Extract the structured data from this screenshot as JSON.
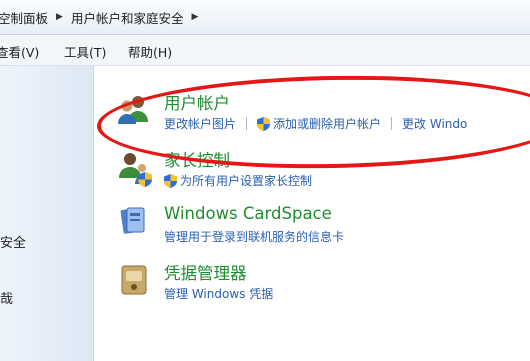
{
  "breadcrumb": {
    "items": [
      "控制面板",
      "用户帐户和家庭安全"
    ],
    "leading_partial": "空制面板"
  },
  "menu": {
    "view": "查看(V)",
    "tools": "工具(T)",
    "help": "帮助(H)"
  },
  "left_pane": {
    "partial_link_1": "安全",
    "partial_link_2": "哉"
  },
  "categories": [
    {
      "title": "用户帐户",
      "icon": "users-icon",
      "links": [
        "更改帐户图片",
        "添加或删除用户帐户",
        "更改 Windo"
      ]
    },
    {
      "title": "家长控制",
      "icon": "parental-controls-icon",
      "links": [
        "为所有用户设置家长控制"
      ]
    },
    {
      "title": "Windows CardSpace",
      "icon": "cardspace-icon",
      "links": [
        "管理用于登录到联机服务的信息卡"
      ]
    },
    {
      "title": "凭据管理器",
      "icon": "credential-manager-icon",
      "links": [
        "管理 Windows 凭据"
      ]
    }
  ],
  "annotation": {
    "color": "#e41717"
  },
  "colors": {
    "title_green": "#1e8e30",
    "link_blue": "#2a5fb0"
  }
}
